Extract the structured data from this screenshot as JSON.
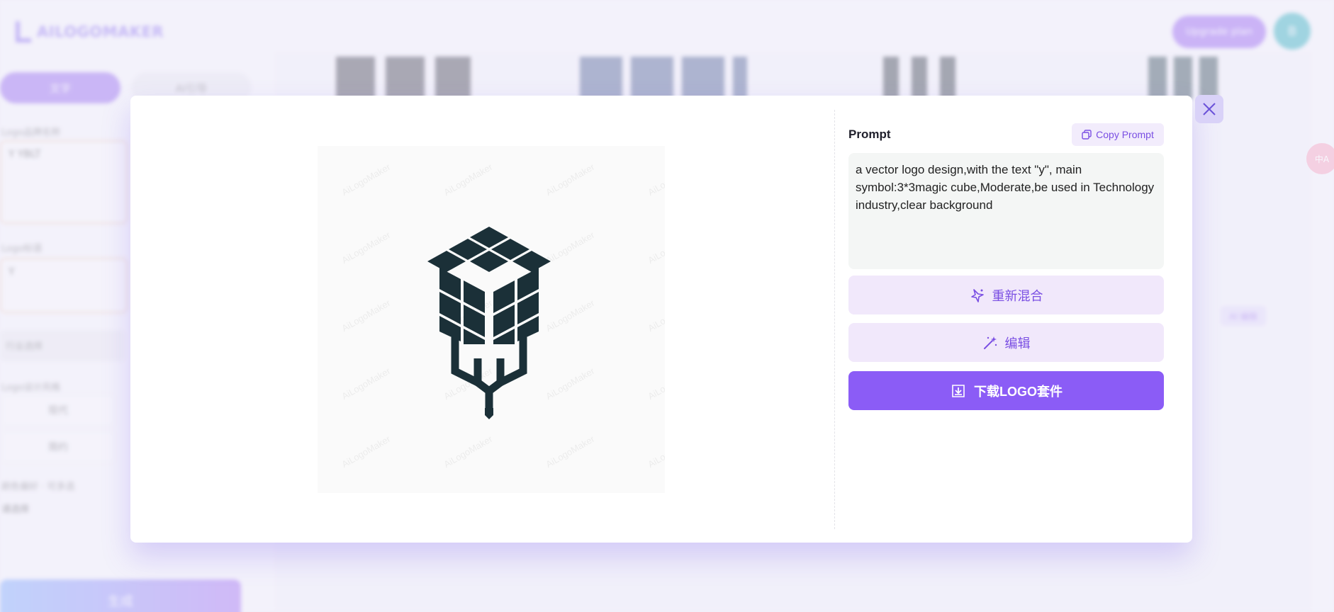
{
  "background": {
    "brand": "AILOGOMAKER",
    "top_button": "Upgrade plan",
    "avatar_letter": "B",
    "tab_active": "文字",
    "tab_inactive": "AI引导",
    "label_name": "Logo品牌名称",
    "name_value": "Y YBLT",
    "label_slogan": "Logo标语",
    "slogan_value": "Y",
    "industry_row": "行业选择",
    "label_style": "Logo设计风格",
    "chip_1": "现代",
    "chip_2": "简约",
    "label_colors": "颜色偏好 · 可多选",
    "color_value": "请选择",
    "generate": "生成",
    "side_badge": "中A",
    "purple_chip": "AI 编辑"
  },
  "modal": {
    "prompt_title": "Prompt",
    "copy_prompt": "Copy Prompt",
    "prompt_text": "a vector logo design,with the text \"y\", main symbol:3*3magic cube,Moderate,be used in Technology industry,clear background",
    "remix_label": "重新混合",
    "edit_label": "编辑",
    "download_label": "下载LOGO套件",
    "watermark_text": "AiLogoMaker"
  },
  "colors": {
    "accent": "#8b5cf6",
    "accent_light": "#f1e8fb",
    "logo_dark": "#1b3038"
  },
  "icons": {
    "close": "close-icon",
    "copy": "copy-icon",
    "remix": "sparkle-icon",
    "edit": "magic-wand-icon",
    "download": "download-icon"
  }
}
